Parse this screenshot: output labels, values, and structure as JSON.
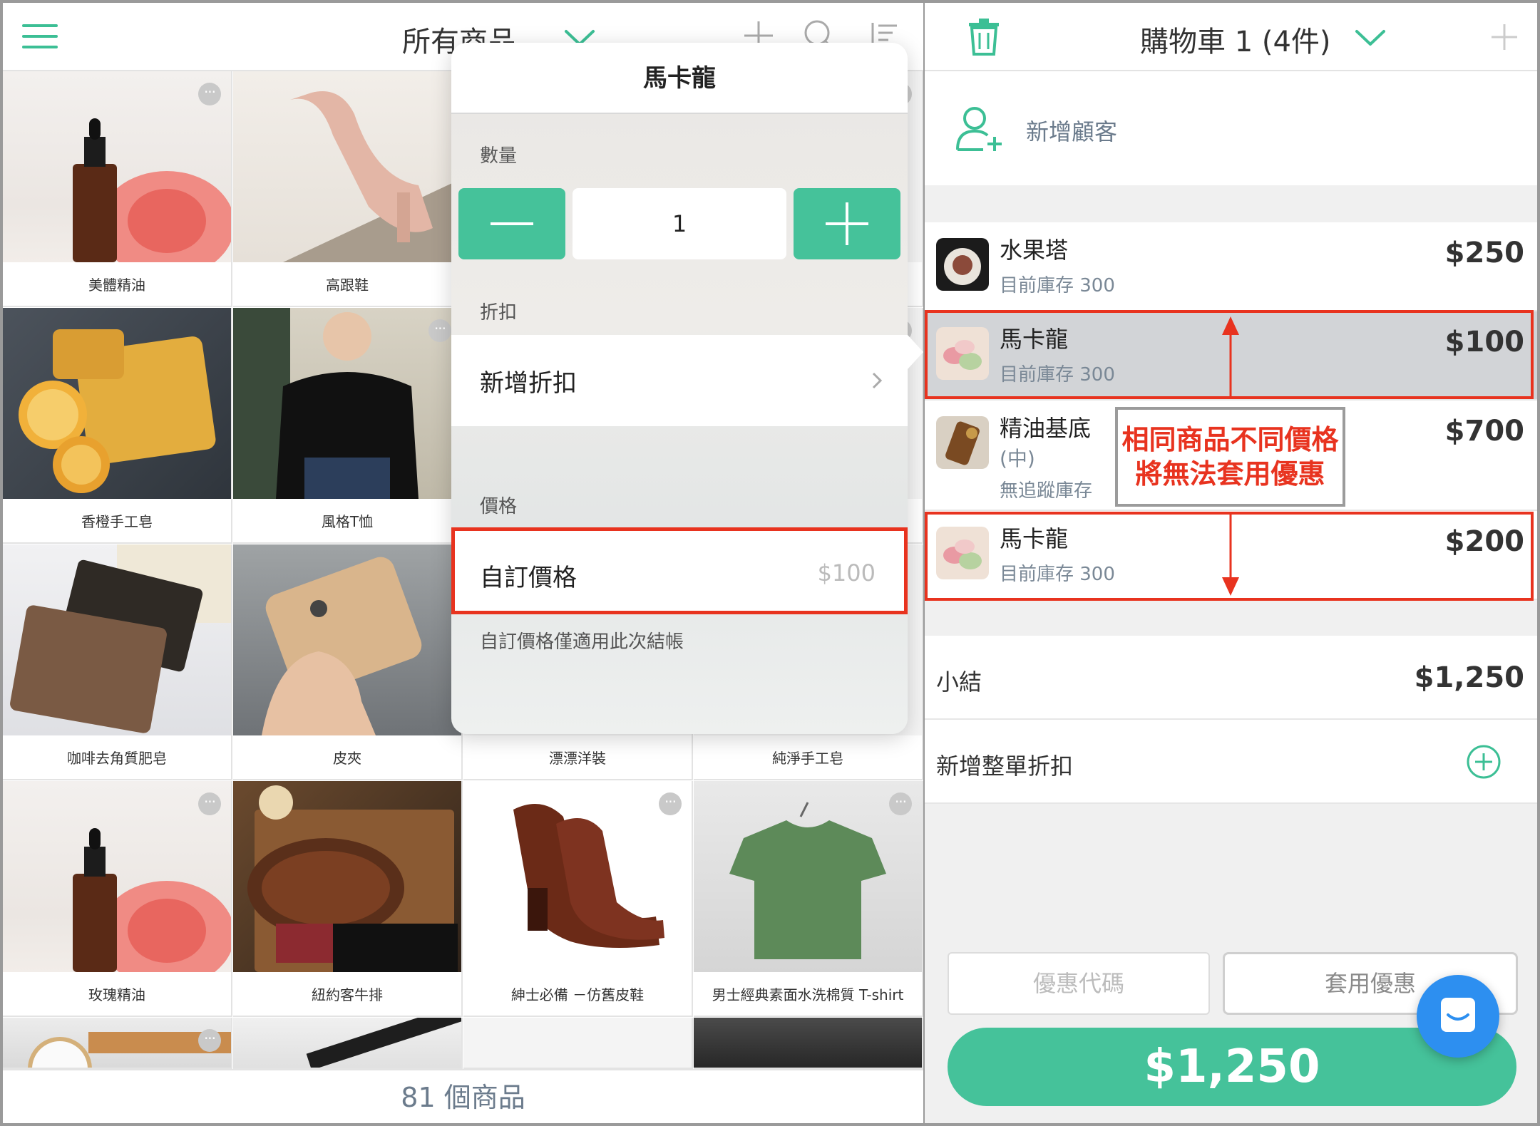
{
  "left": {
    "header": {
      "title": "所有商品",
      "icons": [
        "menu-icon",
        "chevron-down-icon",
        "plus-icon",
        "search-icon",
        "sort-icon"
      ]
    },
    "products": [
      {
        "name": "美體精油"
      },
      {
        "name": "高跟鞋"
      },
      {
        "name": ""
      },
      {
        "name": ""
      },
      {
        "name": "香橙手工皂"
      },
      {
        "name": "風格T恤"
      },
      {
        "name": ""
      },
      {
        "name": ""
      },
      {
        "name": "咖啡去角質肥皂"
      },
      {
        "name": "皮夾"
      },
      {
        "name": "漂漂洋裝"
      },
      {
        "name": "純淨手工皂"
      },
      {
        "name": "玫瑰精油"
      },
      {
        "name": "紐約客牛排"
      },
      {
        "name": "紳士必備 －仿舊皮鞋"
      },
      {
        "name": "男士經典素面水洗棉質 T-shirt"
      }
    ],
    "footer": {
      "count_label": "81 個商品"
    }
  },
  "popover": {
    "title": "馬卡龍",
    "quantity_label": "數量",
    "quantity_value": "1",
    "discount_section": "折扣",
    "discount_add": "新增折扣",
    "price_section": "價格",
    "custom_price_label": "自訂價格",
    "custom_price_value": "$100",
    "custom_price_note": "自訂價格僅適用此次結帳"
  },
  "cart": {
    "title": "購物車 1 (4件)",
    "add_customer": "新增顧客",
    "items": [
      {
        "name": "水果塔",
        "sub": "目前庫存 300",
        "price": "$250"
      },
      {
        "name": "馬卡龍",
        "sub": "目前庫存 300",
        "price": "$100"
      },
      {
        "name": "精油基底",
        "name2": "(中)",
        "sub": "無追蹤庫存",
        "price": "$700"
      },
      {
        "name": "馬卡龍",
        "sub": "目前庫存 300",
        "price": "$200"
      }
    ],
    "subtotal_label": "小結",
    "subtotal_value": "$1,250",
    "order_discount_label": "新增整單折扣",
    "coupon_placeholder": "優惠代碼",
    "apply_label": "套用優惠",
    "checkout_total": "$1,250"
  },
  "annotation": {
    "line1": "相同商品不同價格",
    "line2": "將無法套用優惠"
  },
  "colors": {
    "accent": "#45c29a",
    "highlight_red": "#e8331f",
    "chat_blue": "#2d8ff0"
  }
}
